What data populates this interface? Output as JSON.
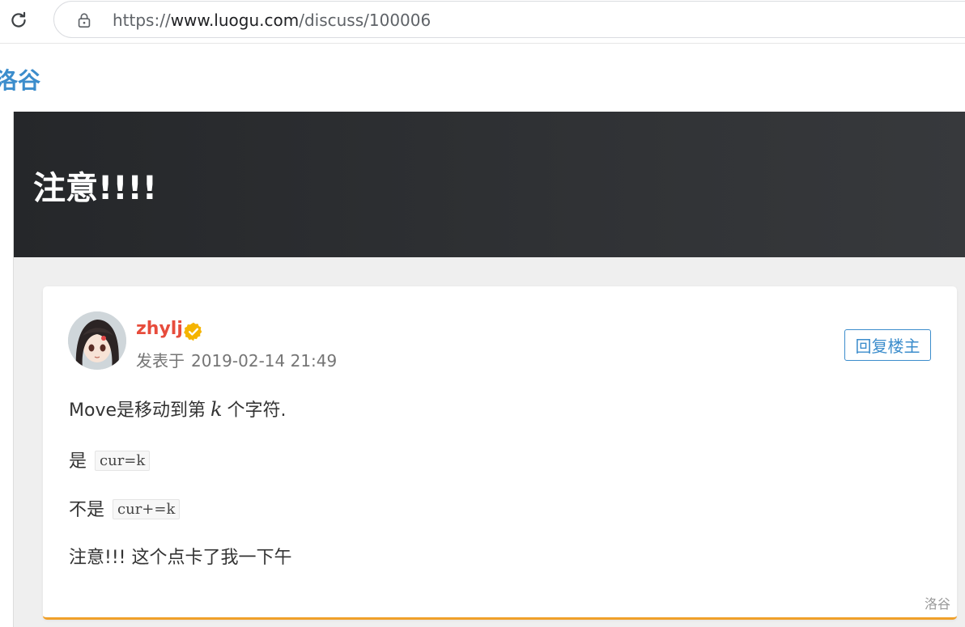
{
  "browser": {
    "url_scheme": "https://",
    "url_host": "www.luogu.com",
    "url_path": "/discuss/100006"
  },
  "site": {
    "logo": "洛谷"
  },
  "banner": {
    "title": "注意!!!!"
  },
  "post": {
    "author": "zhylj",
    "posted_label": "发表于",
    "posted_time": "2019-02-14 21:49",
    "reply_button": "回复楼主",
    "lines": {
      "line1_before": "Move是移动到第",
      "line1_math": "k",
      "line1_after": "个字符.",
      "line2_text": "是",
      "line2_code": "cur=k",
      "line3_text": "不是",
      "line3_code": "cur+=k",
      "line4_text": "注意!!! 这个点卡了我一下午"
    },
    "watermark": "洛谷"
  },
  "colors": {
    "brand_blue": "#3c8dcc",
    "username_red": "#e74c3c",
    "card_accent": "#f0a02a",
    "verified_gold": "#f5b400",
    "banner_dark": "#2a2c2f"
  },
  "icons": {
    "reload": "reload-icon",
    "lock": "lock-icon",
    "verified": "verified-badge-icon"
  }
}
